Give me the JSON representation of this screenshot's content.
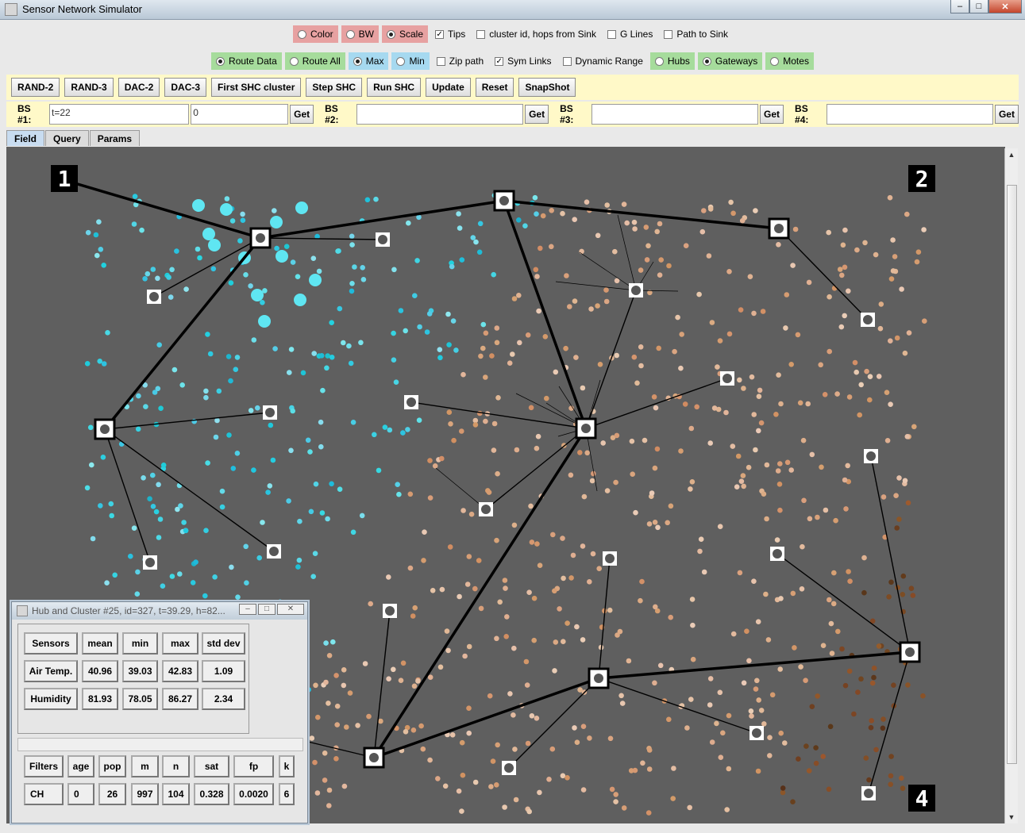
{
  "window": {
    "title": "Sensor Network Simulator"
  },
  "row1": {
    "radios": [
      {
        "label": "Color",
        "checked": false
      },
      {
        "label": "BW",
        "checked": false
      },
      {
        "label": "Scale",
        "checked": true
      }
    ],
    "checks": [
      {
        "label": "Tips",
        "checked": true
      },
      {
        "label": "cluster id, hops from Sink",
        "checked": false
      },
      {
        "label": "G Lines",
        "checked": false
      },
      {
        "label": "Path to Sink",
        "checked": false
      }
    ]
  },
  "row2": {
    "route": [
      {
        "label": "Route Data",
        "checked": true
      },
      {
        "label": "Route All",
        "checked": false
      }
    ],
    "mode": [
      {
        "label": "Max",
        "checked": true
      },
      {
        "label": "Min",
        "checked": false
      }
    ],
    "checks": [
      {
        "label": "Zip path",
        "checked": false
      },
      {
        "label": "Sym Links",
        "checked": true
      },
      {
        "label": "Dynamic Range",
        "checked": false
      }
    ],
    "show": [
      {
        "label": "Hubs",
        "checked": false
      },
      {
        "label": "Gateways",
        "checked": true
      },
      {
        "label": "Motes",
        "checked": false
      }
    ]
  },
  "toolbar": [
    "RAND-2",
    "RAND-3",
    "DAC-2",
    "DAC-3",
    "First SHC cluster",
    "Step SHC",
    "Run SHC",
    "Update",
    "Reset",
    "SnapShot"
  ],
  "basestations": {
    "bs1": {
      "label": "BS #1:",
      "query": "t=22",
      "value": "0",
      "get": "Get"
    },
    "bs2": {
      "label": "BS #2:",
      "query": "",
      "get": "Get"
    },
    "bs3": {
      "label": "BS #3:",
      "query": "",
      "get": "Get"
    },
    "bs4": {
      "label": "BS #4:",
      "query": "",
      "get": "Get"
    }
  },
  "tabs": [
    "Field",
    "Query",
    "Params"
  ],
  "field": {
    "bs_markers": [
      "1",
      "2",
      "4"
    ]
  },
  "popup": {
    "title": "Hub and Cluster #25, id=327, t=39.29, h=82...",
    "stats_header": [
      "Sensors",
      "mean",
      "min",
      "max",
      "std dev"
    ],
    "stats_rows": [
      [
        "Air Temp.",
        "40.96",
        "39.03",
        "42.83",
        "1.09"
      ],
      [
        "Humidity",
        "81.93",
        "78.05",
        "86.27",
        "2.34"
      ]
    ],
    "filters_header": [
      "Filters",
      "age",
      "pop",
      "m",
      "n",
      "sat",
      "fp",
      "k"
    ],
    "filters_row": [
      "CH",
      "0",
      "26",
      "997",
      "104",
      "0.328",
      "0.0020",
      "6"
    ]
  },
  "colors": {
    "field_bg": "#5f5f5f",
    "cool": "#5fe0ec",
    "warm": "#d9a17a",
    "toolbar_bg": "#fff9c8"
  }
}
